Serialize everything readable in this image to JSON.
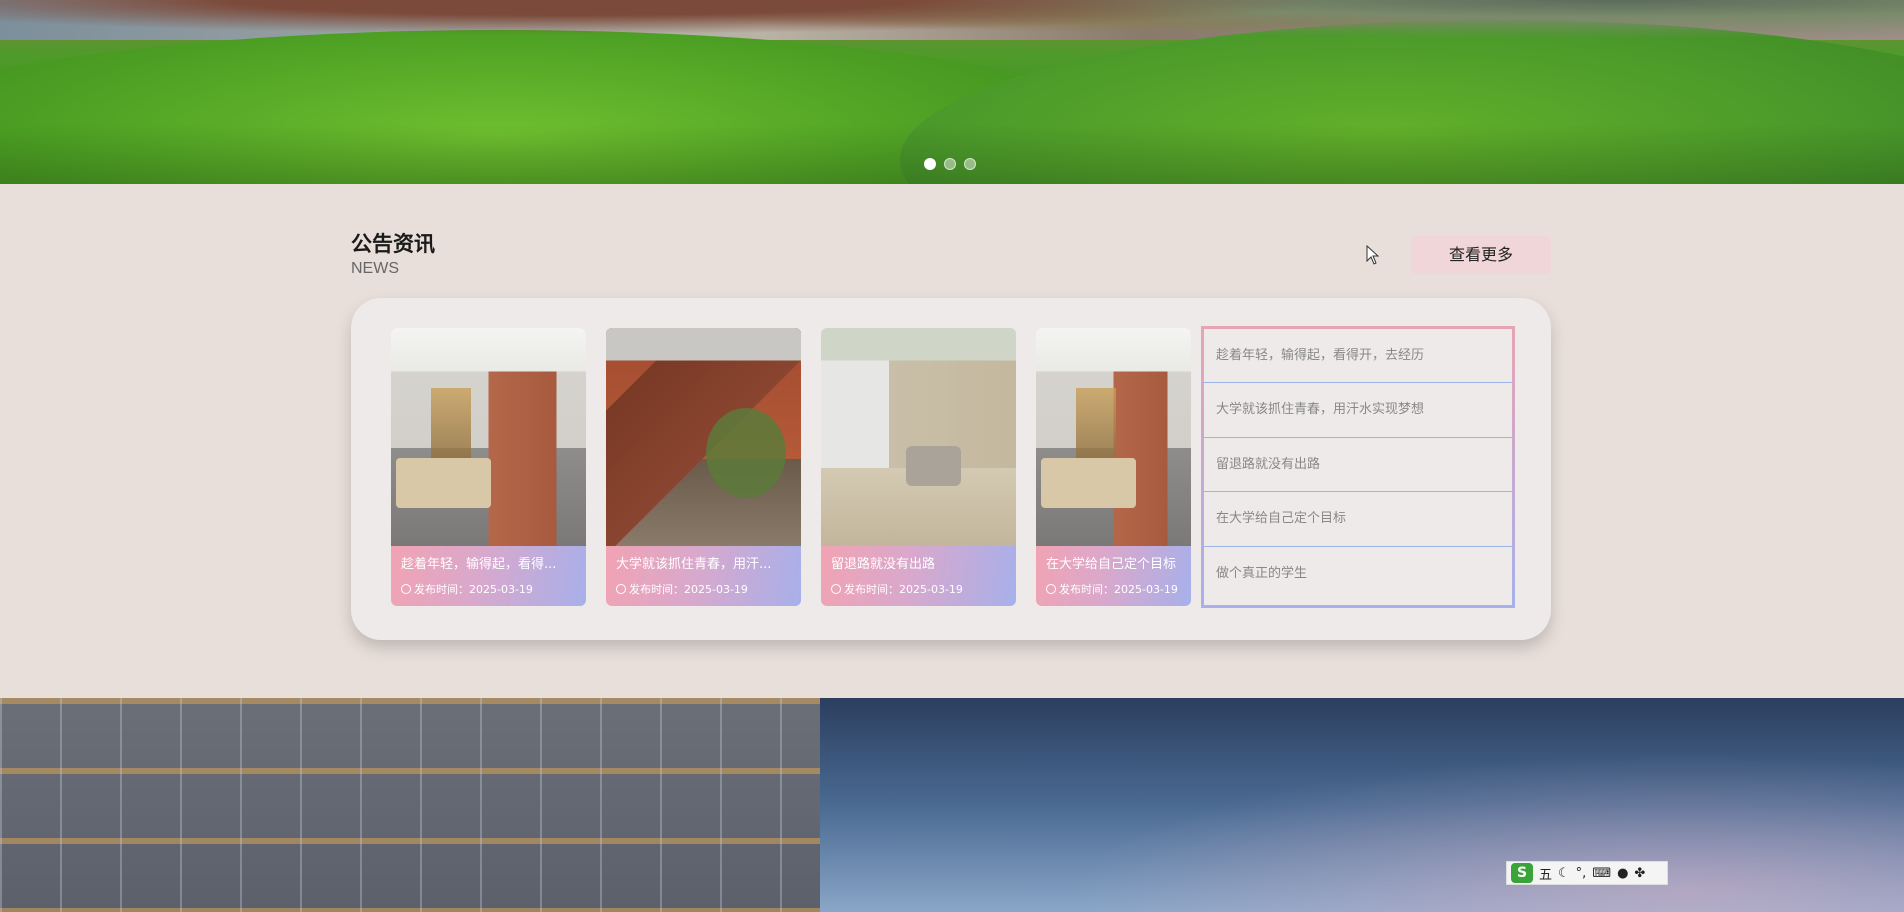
{
  "hero": {
    "carousel_dots": [
      {
        "active": true
      },
      {
        "active": false
      },
      {
        "active": false
      }
    ]
  },
  "news": {
    "title": "公告资讯",
    "subtitle": "NEWS",
    "more_label": "查看更多",
    "cards": [
      {
        "title": "趁着年轻，输得起，看得...",
        "date": "发布时间：2025-03-19",
        "image": "interior-photo"
      },
      {
        "title": "大学就该抓住青春，用汗...",
        "date": "发布时间：2025-03-19",
        "image": "house-photo"
      },
      {
        "title": "留退路就没有出路",
        "date": "发布时间：2025-03-19",
        "image": "patio-photo"
      },
      {
        "title": "在大学给自己定个目标",
        "date": "发布时间：2025-03-19",
        "image": "interior-photo"
      }
    ],
    "list": [
      "趁着年轻，输得起，看得开，去经历",
      "大学就该抓住青春，用汗水实现梦想",
      "留退路就没有出路",
      "在大学给自己定个目标",
      "做个真正的学生"
    ]
  },
  "ime": {
    "logo": "S",
    "mode": "五",
    "icons": [
      "moon-icon",
      "punctuation-icon",
      "keyboard-icon",
      "user-icon",
      "apps-icon"
    ]
  },
  "colors": {
    "section_bg": "#e9dfda",
    "button_bg": "#f0d6d8",
    "caption_gradient_start": "#f1a3b3",
    "caption_gradient_end": "#a7b0ea"
  }
}
